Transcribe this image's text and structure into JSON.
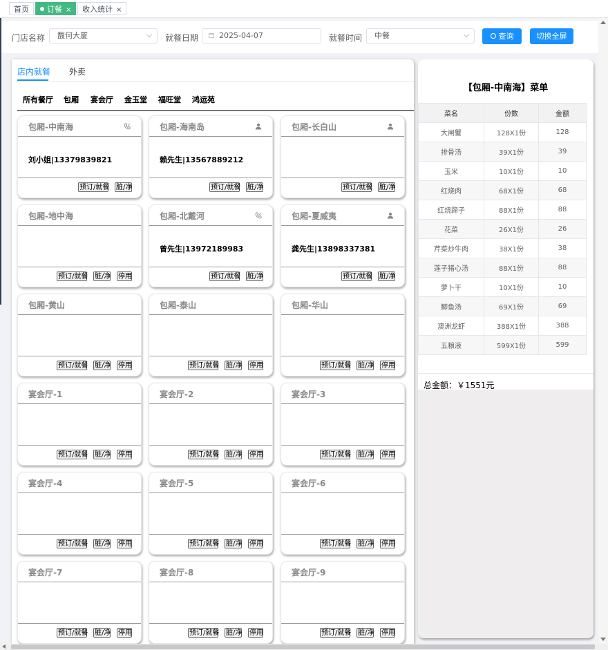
{
  "tabs": [
    {
      "label": "首页",
      "active": false,
      "closable": false
    },
    {
      "label": "订餐",
      "active": true,
      "closable": true
    },
    {
      "label": "收入统计",
      "active": false,
      "closable": true
    }
  ],
  "tab_close_glyph": "×",
  "filters": {
    "store_label": "门店名称",
    "store_value": "馥何大厦",
    "date_label": "就餐日期",
    "date_value": "2025-04-07",
    "time_label": "就餐时间",
    "time_value": "中餐",
    "query_button": "查询",
    "fullscreen_button": "切换全屏"
  },
  "dining_tabs": [
    "店内就餐",
    "外卖"
  ],
  "active_dining_tab": 0,
  "halls": [
    "所有餐厅",
    "包厢",
    "宴会厅",
    "金玉堂",
    "福旺堂",
    "鸿运苑"
  ],
  "card_buttons": {
    "reserve": "预订/就餐",
    "dirty": "脏/净",
    "disable": "停用"
  },
  "rooms": [
    {
      "name": "包厢-中南海",
      "icon": "phone-icon",
      "guest": "刘小姐|13379839821",
      "buttons": [
        "reserve",
        "dirty"
      ]
    },
    {
      "name": "包厢-海南岛",
      "icon": "user-icon",
      "guest": "赖先生|13567889212",
      "buttons": [
        "reserve",
        "dirty"
      ]
    },
    {
      "name": "包厢-长白山",
      "icon": "user-icon",
      "guest": "",
      "buttons": [
        "reserve",
        "dirty"
      ]
    },
    {
      "name": "包厢-地中海",
      "icon": "",
      "guest": "",
      "buttons": [
        "reserve",
        "dirty",
        "disable"
      ]
    },
    {
      "name": "包厢-北戴河",
      "icon": "phone-icon",
      "guest": "曾先生|13972189983",
      "buttons": [
        "reserve",
        "dirty"
      ]
    },
    {
      "name": "包厢-夏威夷",
      "icon": "user-icon",
      "guest": "龚先生|13898337381",
      "buttons": [
        "reserve",
        "dirty"
      ]
    },
    {
      "name": "包厢-黄山",
      "icon": "",
      "guest": "",
      "buttons": [
        "reserve",
        "dirty",
        "disable"
      ]
    },
    {
      "name": "包厢-泰山",
      "icon": "",
      "guest": "",
      "buttons": [
        "reserve",
        "dirty",
        "disable"
      ]
    },
    {
      "name": "包厢-华山",
      "icon": "",
      "guest": "",
      "buttons": [
        "reserve",
        "dirty",
        "disable"
      ]
    },
    {
      "name": "宴会厅-1",
      "icon": "",
      "guest": "",
      "buttons": [
        "reserve",
        "dirty",
        "disable"
      ]
    },
    {
      "name": "宴会厅-2",
      "icon": "",
      "guest": "",
      "buttons": [
        "reserve",
        "dirty",
        "disable"
      ]
    },
    {
      "name": "宴会厅-3",
      "icon": "",
      "guest": "",
      "buttons": [
        "reserve",
        "dirty",
        "disable"
      ]
    },
    {
      "name": "宴会厅-4",
      "icon": "",
      "guest": "",
      "buttons": [
        "reserve",
        "dirty",
        "disable"
      ]
    },
    {
      "name": "宴会厅-5",
      "icon": "",
      "guest": "",
      "buttons": [
        "reserve",
        "dirty",
        "disable"
      ]
    },
    {
      "name": "宴会厅-6",
      "icon": "",
      "guest": "",
      "buttons": [
        "reserve",
        "dirty",
        "disable"
      ]
    },
    {
      "name": "宴会厅-7",
      "icon": "",
      "guest": "",
      "buttons": [
        "reserve",
        "dirty",
        "disable"
      ]
    },
    {
      "name": "宴会厅-8",
      "icon": "",
      "guest": "",
      "buttons": [
        "reserve",
        "dirty",
        "disable"
      ]
    },
    {
      "name": "宴会厅-9",
      "icon": "",
      "guest": "",
      "buttons": [
        "reserve",
        "dirty",
        "disable"
      ]
    }
  ],
  "menu": {
    "title": "【包厢-中南海】菜单",
    "headers": [
      "菜名",
      "份数",
      "金额"
    ],
    "items": [
      {
        "name": "大闸蟹",
        "qty": "128X1份",
        "amount": "128"
      },
      {
        "name": "排骨汤",
        "qty": "39X1份",
        "amount": "39"
      },
      {
        "name": "玉米",
        "qty": "10X1份",
        "amount": "10"
      },
      {
        "name": "红烧肉",
        "qty": "68X1份",
        "amount": "68"
      },
      {
        "name": "红烧蹄子",
        "qty": "88X1份",
        "amount": "88"
      },
      {
        "name": "花菜",
        "qty": "26X1份",
        "amount": "26"
      },
      {
        "name": "芹菜炒牛肉",
        "qty": "38X1份",
        "amount": "38"
      },
      {
        "name": "莲子猪心汤",
        "qty": "88X1份",
        "amount": "88"
      },
      {
        "name": "萝卜干",
        "qty": "10X1份",
        "amount": "10"
      },
      {
        "name": "鲫鱼汤",
        "qty": "69X1份",
        "amount": "69"
      },
      {
        "name": "澳洲龙虾",
        "qty": "388X1份",
        "amount": "388"
      },
      {
        "name": "五粮液",
        "qty": "599X1份",
        "amount": "599"
      }
    ],
    "total": "总金额：￥1551元"
  },
  "colors": {
    "primary": "#1890ff",
    "active_tab": "#42b983",
    "card_title": "#888888"
  }
}
